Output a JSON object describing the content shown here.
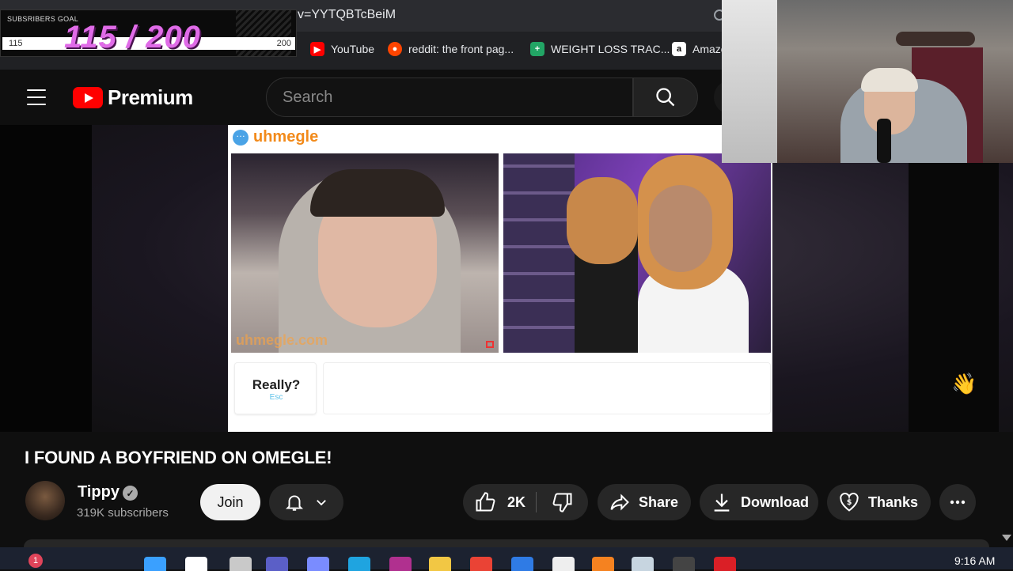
{
  "browser": {
    "url_fragment": "v=YYTQBTcBeiM",
    "bookmarks": [
      {
        "label": "YouTube",
        "icon": "youtube-icon",
        "color": "#ff0000"
      },
      {
        "label": "reddit: the front pag...",
        "icon": "reddit-icon",
        "color": "#ff4500"
      },
      {
        "label": "WEIGHT LOSS TRAC...",
        "icon": "sheets-icon",
        "color": "#22a565"
      },
      {
        "label": "Amazo",
        "icon": "amazon-icon",
        "color": "#ffffff"
      }
    ]
  },
  "subscriber_goal": {
    "label": "SUBSRIBERS GOAL",
    "current": "115",
    "target": "200",
    "display": "115 / 200",
    "progress_fraction": 0.575
  },
  "youtube": {
    "logo_text": "Premium",
    "search_placeholder": "Search"
  },
  "video": {
    "site_logo": "uhmegle",
    "watermark": "uhmegle.com",
    "escape_label": "Really?",
    "escape_hint": "Esc",
    "title": "I FOUND A BOYFRIEND ON OMEGLE!"
  },
  "channel": {
    "name": "Tippy",
    "subscribers": "319K subscribers",
    "join_label": "Join"
  },
  "actions": {
    "like_count": "2K",
    "share_label": "Share",
    "download_label": "Download",
    "thanks_label": "Thanks"
  },
  "taskbar": {
    "time": "9:16 AM",
    "notification_count": "1",
    "icons": [
      "start-icon",
      "search-icon",
      "task-view-icon",
      "teams-icon",
      "copilot-icon",
      "edge-icon",
      "app-icon",
      "file-explorer-icon",
      "chrome-icon",
      "store-icon",
      "ghost-icon",
      "vlc-icon",
      "steam-icon",
      "obs-icon",
      "creative-cloud-icon"
    ]
  },
  "colors": {
    "youtube_red": "#ff0000",
    "goal_purple": "#e06be8",
    "uhmegle_orange": "#f28a1a"
  }
}
